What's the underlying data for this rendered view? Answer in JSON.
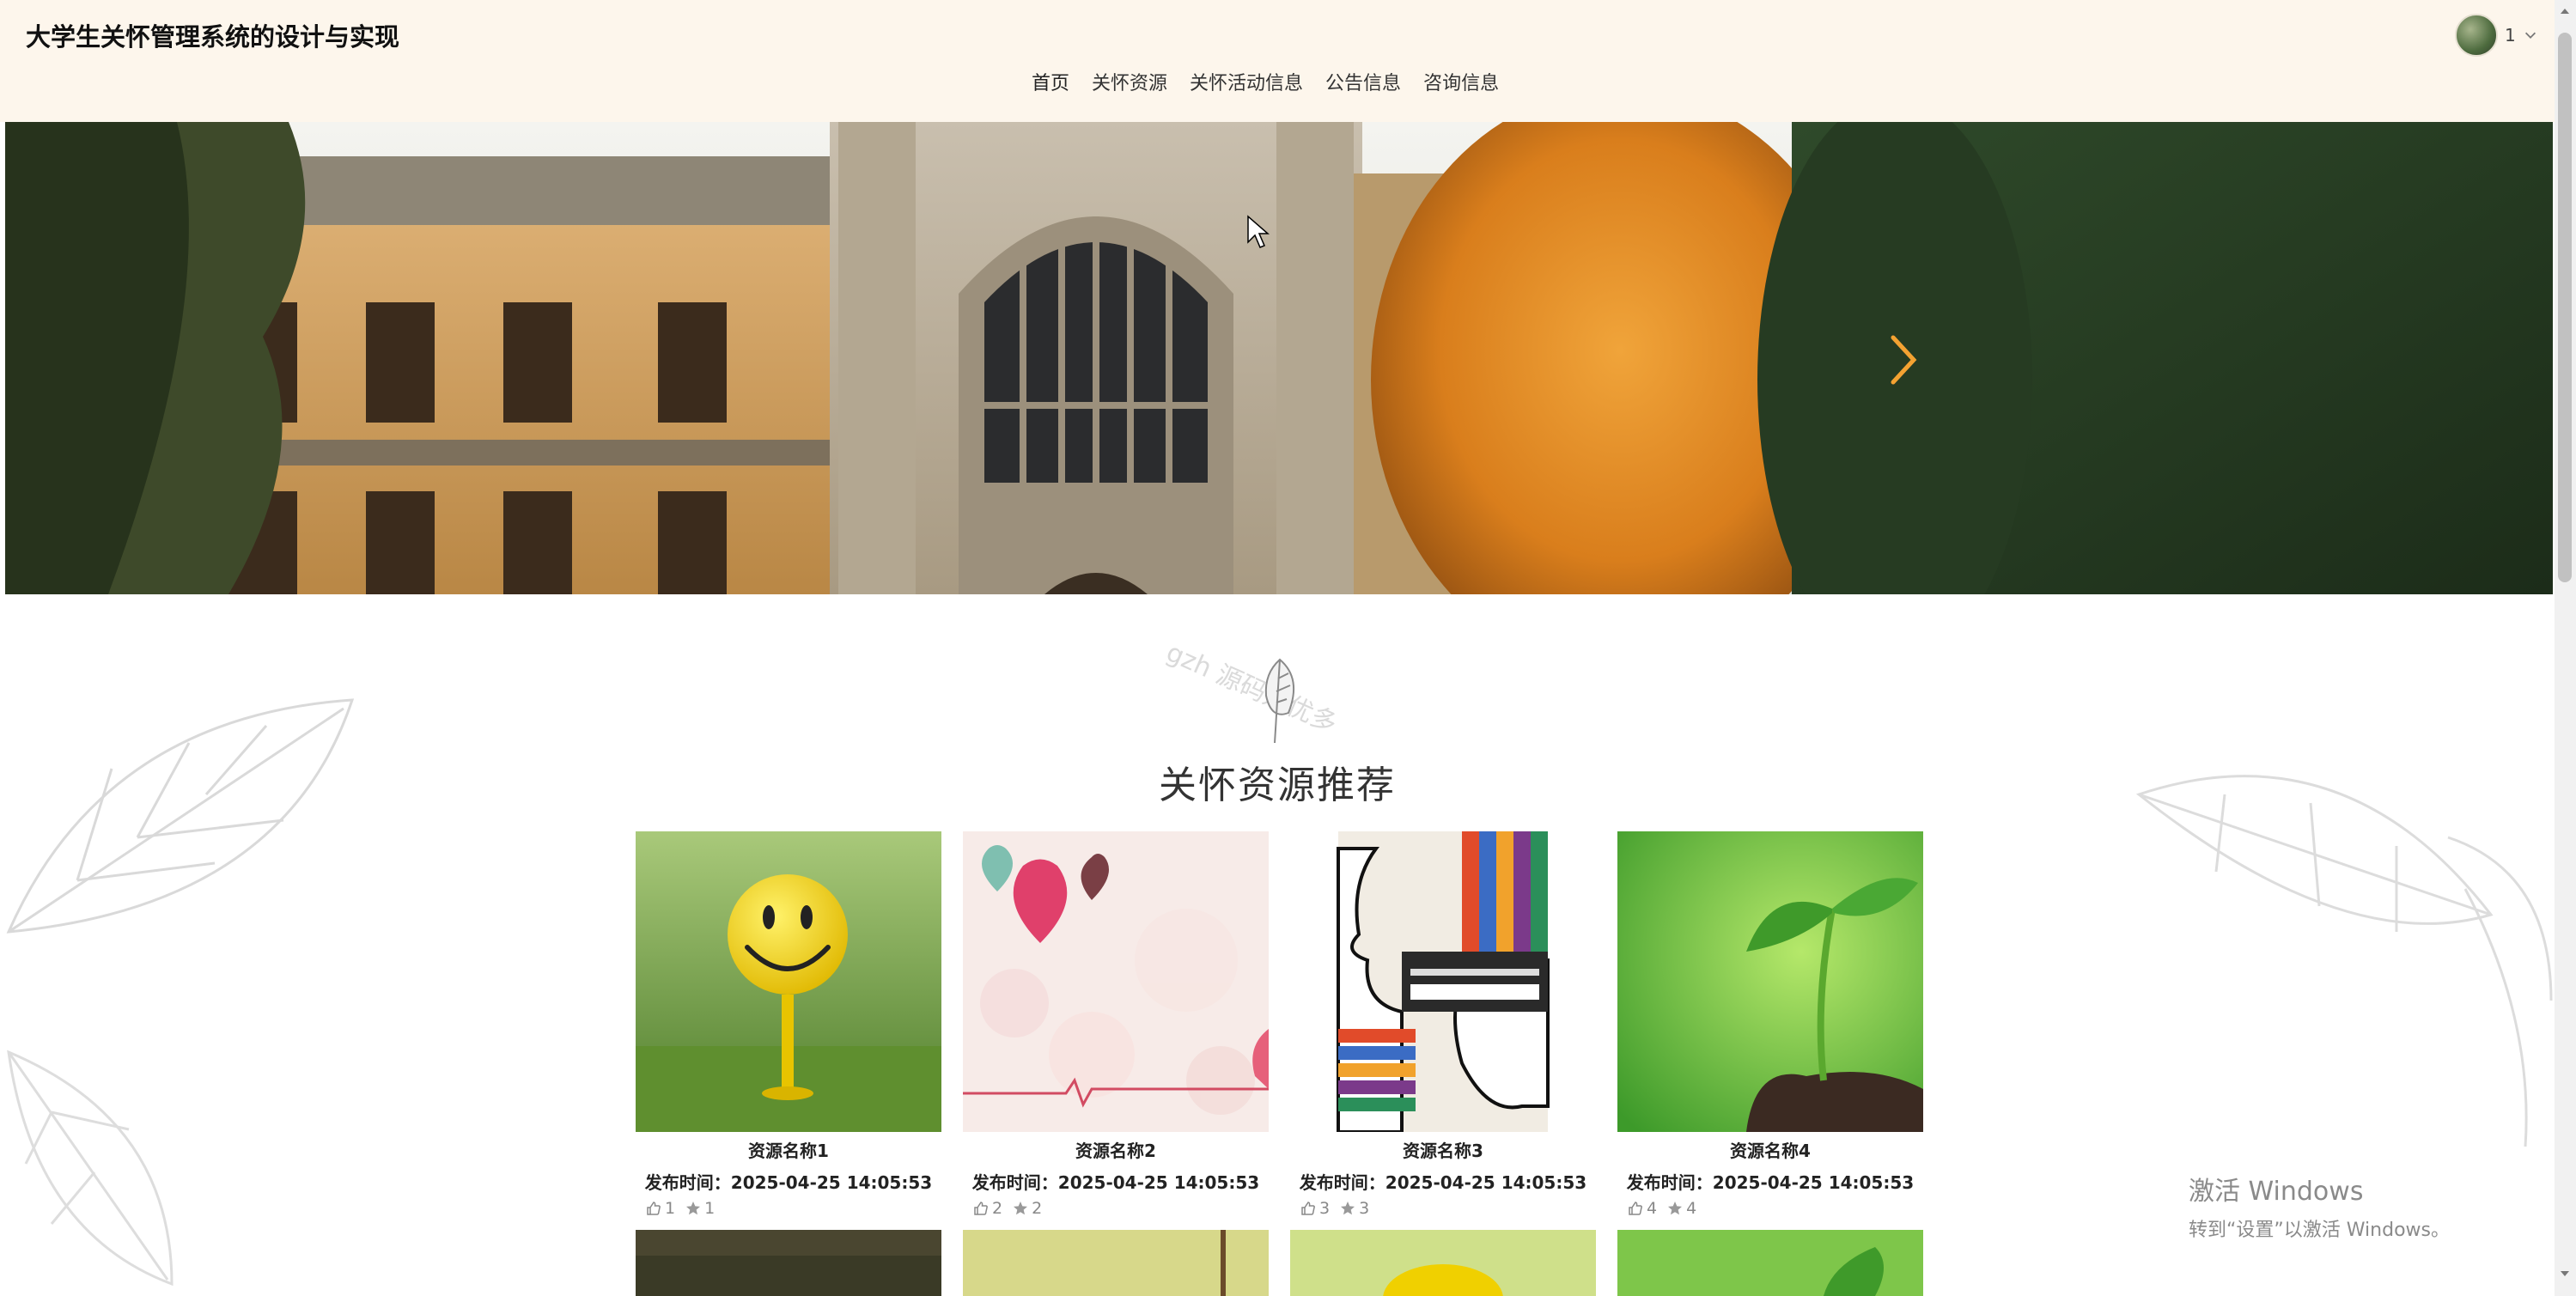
{
  "header": {
    "site_title": "大学生关怀管理系统的设计与实现",
    "user_name": "1"
  },
  "nav": {
    "items": [
      {
        "label": "首页",
        "active": true
      },
      {
        "label": "关怀资源",
        "active": false
      },
      {
        "label": "关怀活动信息",
        "active": false
      },
      {
        "label": "公告信息",
        "active": false
      },
      {
        "label": "咨询信息",
        "active": false
      }
    ]
  },
  "section": {
    "title": "关怀资源推荐",
    "watermark": "gzh 源码好优多"
  },
  "cards": [
    {
      "name": "资源名称1",
      "time": "发布时间：2025-04-25 14:05:53",
      "likes": "1",
      "favorites": "1"
    },
    {
      "name": "资源名称2",
      "time": "发布时间：2025-04-25 14:05:53",
      "likes": "2",
      "favorites": "2"
    },
    {
      "name": "资源名称3",
      "time": "发布时间：2025-04-25 14:05:53",
      "likes": "3",
      "favorites": "3"
    },
    {
      "name": "资源名称4",
      "time": "发布时间：2025-04-25 14:05:53",
      "likes": "4",
      "favorites": "4"
    }
  ],
  "windows_activation": {
    "line1": "激活 Windows",
    "line2": "转到“设置”以激活 Windows。"
  },
  "colors": {
    "header_bg": "#fdf6ec",
    "nav_accent": "#f3a232"
  }
}
